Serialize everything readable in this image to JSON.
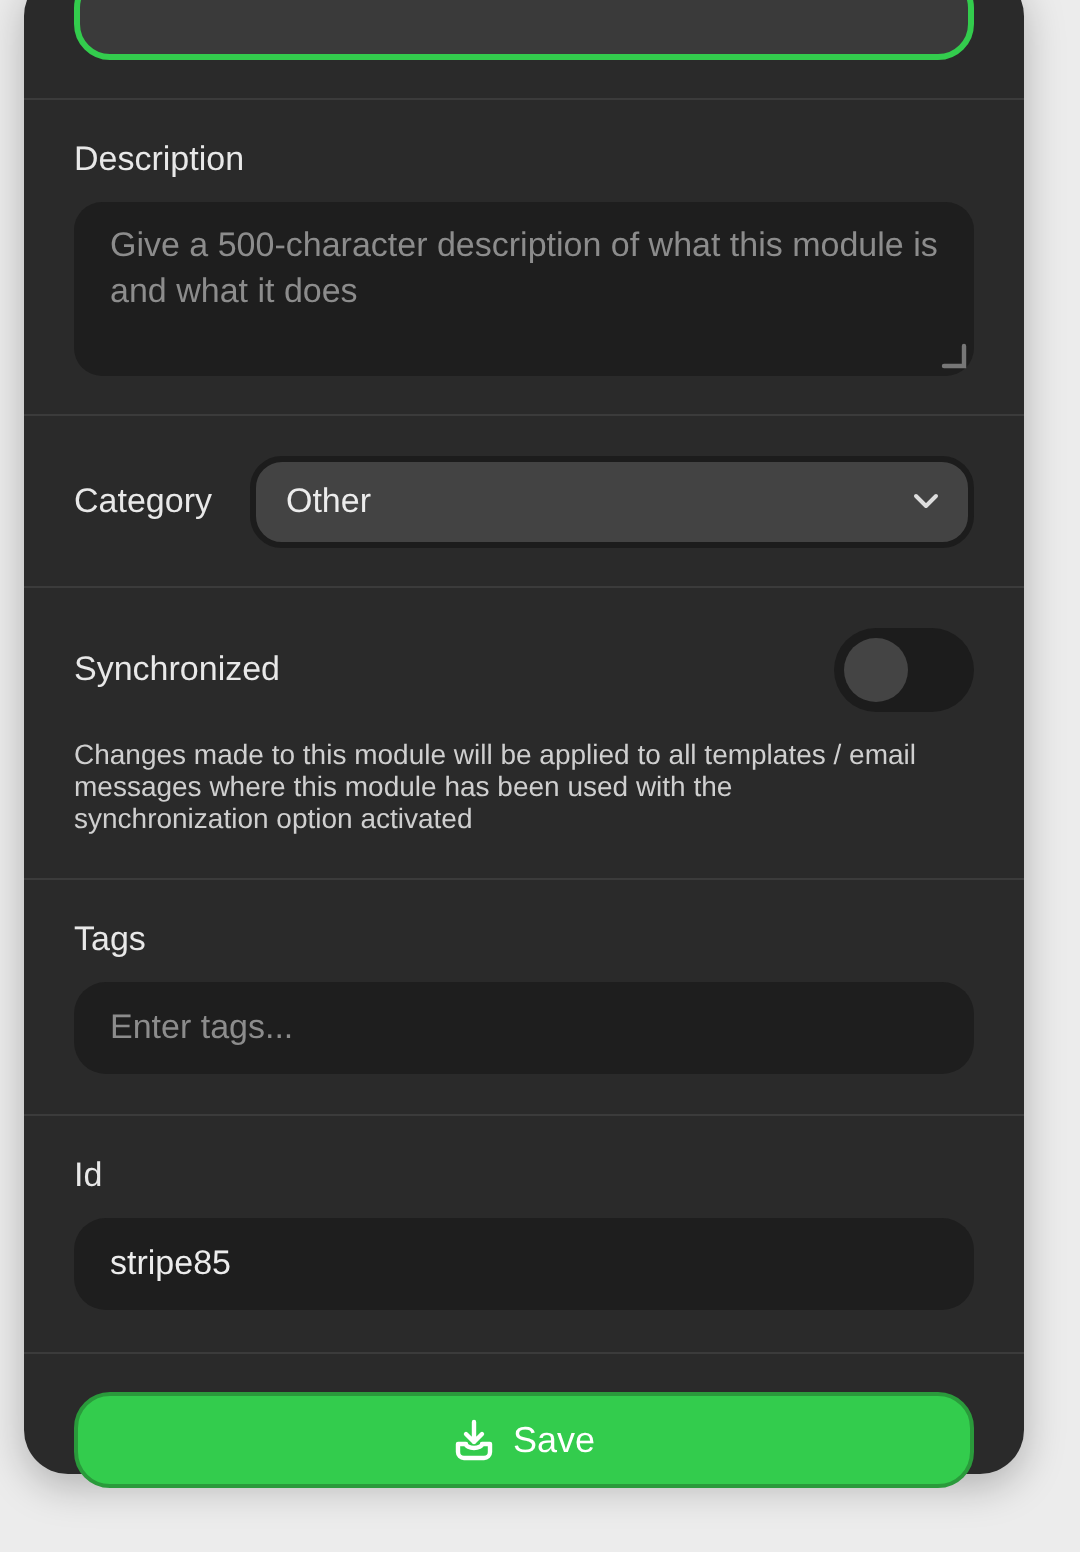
{
  "name_field": {
    "focused": true
  },
  "description": {
    "label": "Description",
    "placeholder": "Give a 500-character description of what this module is and what it does"
  },
  "category": {
    "label": "Category",
    "value": "Other"
  },
  "synchronized": {
    "label": "Synchronized",
    "on": false,
    "help": "Changes made to this module will be applied to all templates / email messages where this module has been used with the synchronization option activated"
  },
  "tags": {
    "label": "Tags",
    "placeholder": "Enter tags..."
  },
  "id": {
    "label": "Id",
    "value": "stripe85"
  },
  "save_button": {
    "label": "Save"
  }
}
